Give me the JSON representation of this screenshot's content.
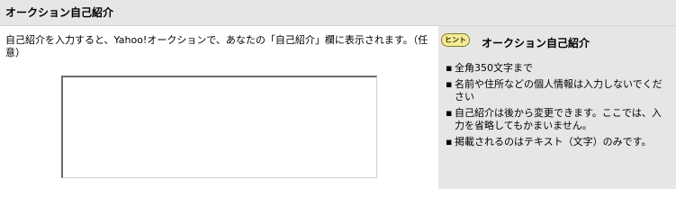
{
  "header": {
    "title": "オークション自己紹介"
  },
  "main": {
    "instruction": "自己紹介を入力すると、Yahoo!オークションで、あなたの「自己紹介」欄に表示されます。（任意）",
    "textarea_value": ""
  },
  "hint": {
    "badge_label": "ヒント",
    "title": "オークション自己紹介",
    "bullet_glyph": "▪",
    "items": [
      {
        "text": "全角350文字まで"
      },
      {
        "text": "名前や住所などの個人情報は入力しないでください"
      },
      {
        "text": "自己紹介は後から変更できます。ここでは、入力を省略してもかまいません。"
      },
      {
        "text": "掲載されるのはテキスト（文字）のみです。"
      }
    ]
  },
  "colors": {
    "header_bg": "#e6e6e6",
    "hint_bg": "#e6e6e6",
    "badge_bg": "#f4ec9a"
  }
}
